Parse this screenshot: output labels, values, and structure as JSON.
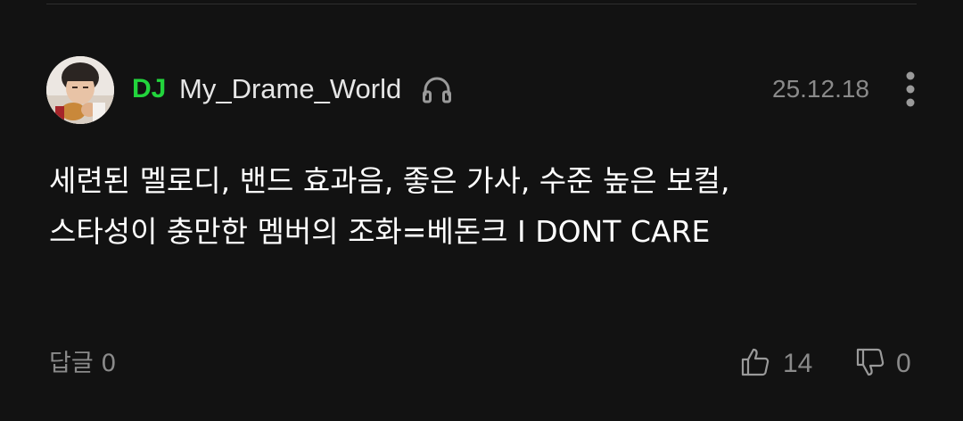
{
  "comment": {
    "badge": "DJ",
    "username": "My_Drame_World",
    "date": "25.12.18",
    "body": "세련된 멜로디, 밴드 효과음, 좋은 가사, 수준 높은 보컬,\n스타성이 충만한 멤버의 조화=베돈크 I DONT CARE",
    "reply_label": "답글 0",
    "likes": "14",
    "dislikes": "0",
    "icons": {
      "user": "headphones-icon",
      "menu": "more-vertical-icon",
      "like": "thumbs-up-icon",
      "dislike": "thumbs-down-icon"
    },
    "colors": {
      "badge": "#22d43c",
      "text": "#ffffff",
      "muted": "#8a8a8a",
      "background": "#121212"
    }
  }
}
